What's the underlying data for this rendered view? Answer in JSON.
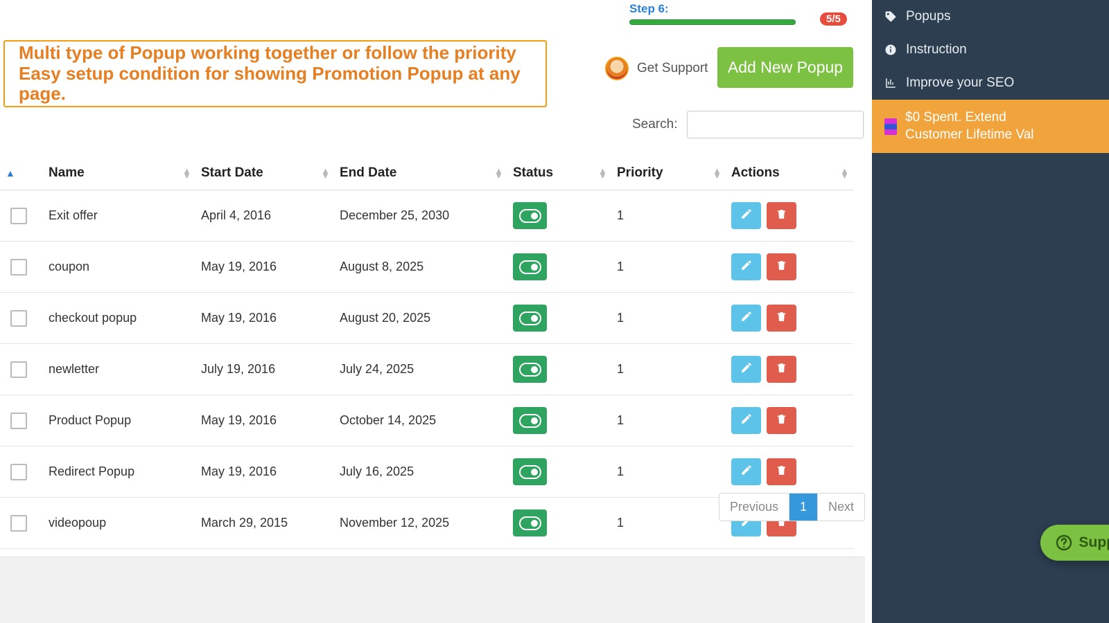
{
  "progress": {
    "step_label": "Step 6:",
    "badge": "5/5"
  },
  "banner": {
    "line1": "Multi type of Popup working together or follow the priority",
    "line2": "Easy setup condition for showing Promotion Popup at any page."
  },
  "support_link": "Get Support",
  "add_button": "Add New Popup",
  "search_label": "Search:",
  "columns": {
    "name": "Name",
    "start": "Start Date",
    "end": "End Date",
    "status": "Status",
    "priority": "Priority",
    "actions": "Actions"
  },
  "rows": [
    {
      "name": "Exit offer",
      "start": "April 4, 2016",
      "end": "December 25, 2030",
      "priority": "1"
    },
    {
      "name": "coupon",
      "start": "May 19, 2016",
      "end": "August 8, 2025",
      "priority": "1"
    },
    {
      "name": "checkout popup",
      "start": "May 19, 2016",
      "end": "August 20, 2025",
      "priority": "1"
    },
    {
      "name": "newletter",
      "start": "July 19, 2016",
      "end": "July 24, 2025",
      "priority": "1"
    },
    {
      "name": "Product Popup",
      "start": "May 19, 2016",
      "end": "October 14, 2025",
      "priority": "1"
    },
    {
      "name": "Redirect Popup",
      "start": "May 19, 2016",
      "end": "July 16, 2025",
      "priority": "1"
    },
    {
      "name": "videopoup",
      "start": "March 29, 2015",
      "end": "November 12, 2025",
      "priority": "1"
    }
  ],
  "pagination": {
    "prev": "Previous",
    "page": "1",
    "next": "Next"
  },
  "sidebar": {
    "popups": "Popups",
    "instruction": "Instruction",
    "seo": "Improve your SEO",
    "promo_line1": "$0 Spent. Extend",
    "promo_line2": "Customer Lifetime Val"
  },
  "fab": "Suppor"
}
